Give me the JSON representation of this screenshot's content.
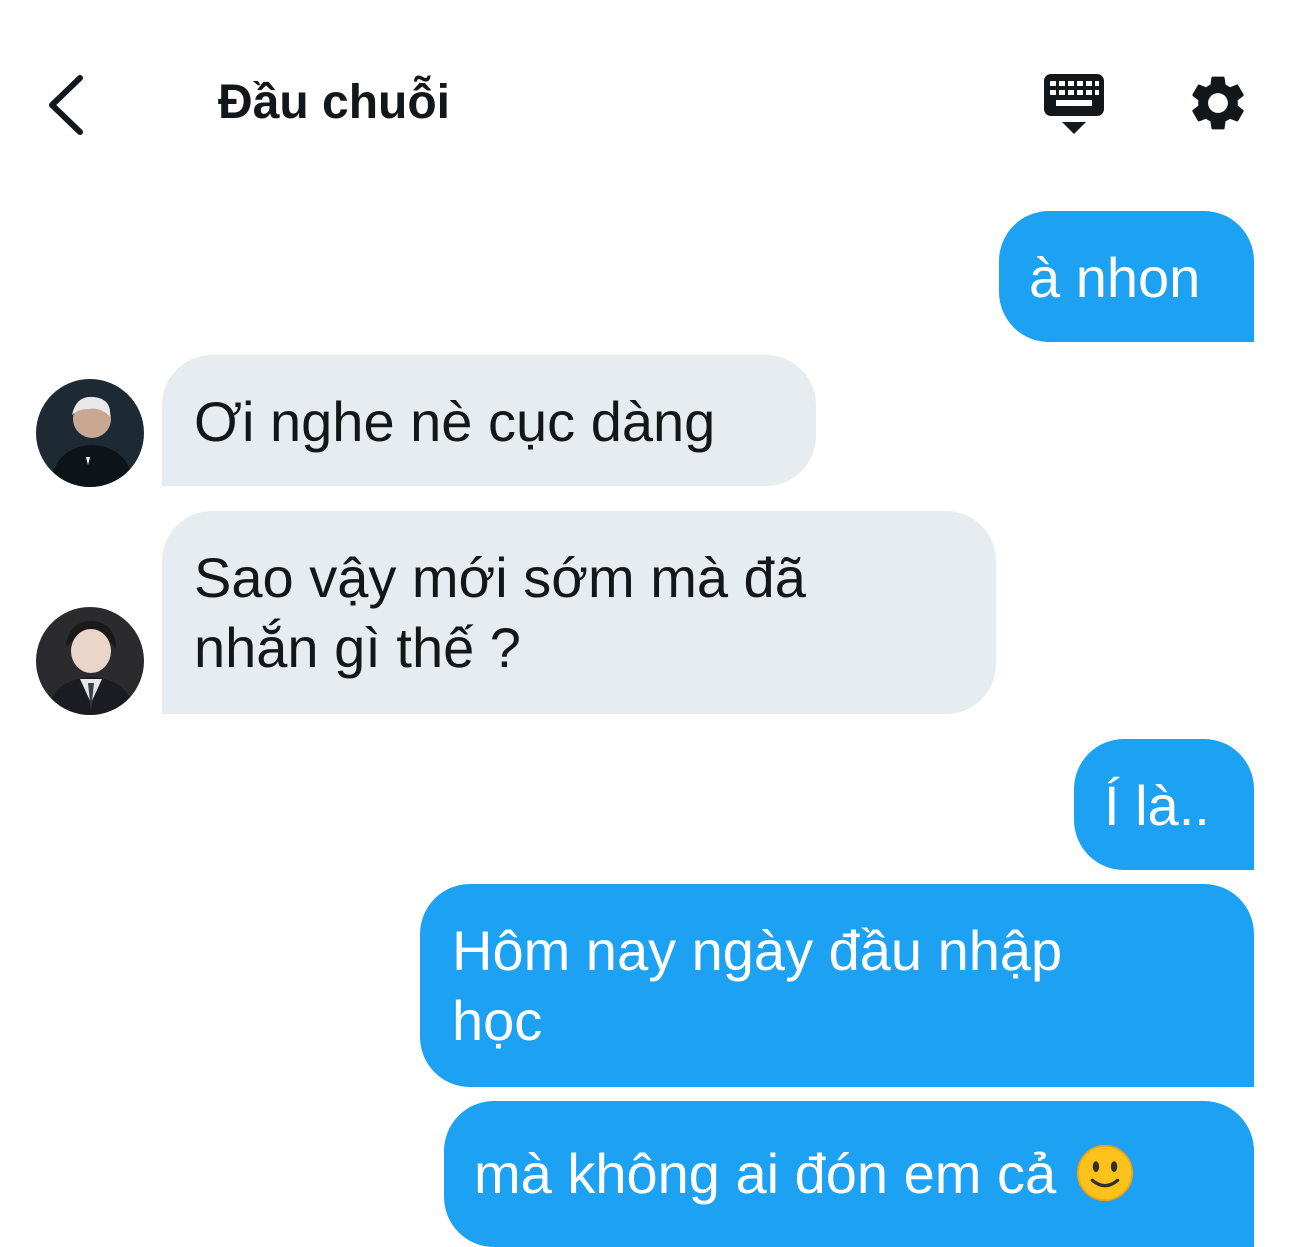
{
  "header": {
    "title": "Đầu chuỗi",
    "back_icon": "chevron-left-icon",
    "keyboard_icon": "keyboard-icon",
    "settings_icon": "gear-icon"
  },
  "colors": {
    "outgoing_bubble": "#1da1f2",
    "incoming_bubble": "#e6ecf0",
    "text_dark": "#14171a"
  },
  "messages": [
    {
      "direction": "out",
      "text": "à nhon"
    },
    {
      "direction": "in",
      "text": "Ơi nghe nè cục dàng"
    },
    {
      "direction": "in",
      "line1": "Sao vậy mới sớm mà đã",
      "line2": "nhắn gì thế ?"
    },
    {
      "direction": "out",
      "text": "Í là.."
    },
    {
      "direction": "out",
      "line1": "Hôm nay ngày đầu nhập",
      "line2": "học"
    },
    {
      "direction": "out",
      "text": "mà không ai đón em cả",
      "emoji": "slightly-smiling-face-emoji"
    }
  ]
}
